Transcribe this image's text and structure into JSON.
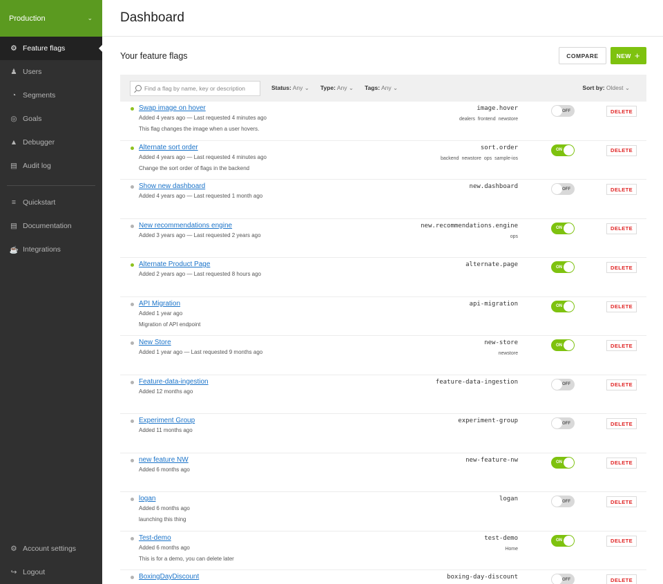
{
  "sidebar": {
    "environment": "Production",
    "nav": [
      {
        "label": "Feature flags",
        "icon": "sliders-icon",
        "active": true
      },
      {
        "label": "Users",
        "icon": "users-icon"
      },
      {
        "label": "Segments",
        "icon": "pie-icon"
      },
      {
        "label": "Goals",
        "icon": "target-icon"
      },
      {
        "label": "Debugger",
        "icon": "bug-icon"
      },
      {
        "label": "Audit log",
        "icon": "log-icon"
      }
    ],
    "nav2": [
      {
        "label": "Quickstart",
        "icon": "rocket-icon"
      },
      {
        "label": "Documentation",
        "icon": "book-icon"
      },
      {
        "label": "Integrations",
        "icon": "plug-icon"
      }
    ],
    "bottom": [
      {
        "label": "Account settings",
        "icon": "gear-icon"
      },
      {
        "label": "Logout",
        "icon": "logout-icon"
      }
    ]
  },
  "header": {
    "title": "Dashboard"
  },
  "section": {
    "title": "Your feature flags",
    "compare": "COMPARE",
    "new": "NEW"
  },
  "filters": {
    "search_placeholder": "Find a flag by name, key or description",
    "status_label": "Status:",
    "status_value": "Any",
    "type_label": "Type:",
    "type_value": "Any",
    "tags_label": "Tags:",
    "tags_value": "Any",
    "sort_label": "Sort by:",
    "sort_value": "Oldest"
  },
  "toggle_labels": {
    "on": "ON",
    "off": "OFF"
  },
  "delete_label": "DELETE",
  "flags": [
    {
      "name": "Swap image on hover",
      "meta": "Added 4 years ago — Last requested 4 minutes ago",
      "desc": "This flag changes the image when a user hovers.",
      "key": "image.hover",
      "tags": [
        "dealers",
        "frontend",
        "newstore"
      ],
      "on": false,
      "live": true
    },
    {
      "name": "Alternate sort order",
      "meta": "Added 4 years ago — Last requested 4 minutes ago",
      "desc": "Change the sort order of flags in the backend",
      "key": "sort.order",
      "tags": [
        "backend",
        "newstore",
        "ops",
        "sample-ios"
      ],
      "on": true,
      "live": true
    },
    {
      "name": "Show new dashboard",
      "meta": "Added 4 years ago — Last requested 1 month ago",
      "desc": "",
      "key": "new.dashboard",
      "tags": [],
      "on": false,
      "live": false
    },
    {
      "name": "New recommendations engine",
      "meta": "Added 3 years ago — Last requested 2 years ago",
      "desc": "",
      "key": "new.recommendations.engine",
      "tags": [
        "ops"
      ],
      "on": true,
      "live": false
    },
    {
      "name": "Alternate Product Page",
      "meta": "Added 2 years ago — Last requested 8 hours ago",
      "desc": "",
      "key": "alternate.page",
      "tags": [],
      "on": true,
      "live": true
    },
    {
      "name": "API Migration",
      "meta": "Added 1 year ago",
      "desc": "Migration of API endpoint",
      "key": "api-migration",
      "tags": [],
      "on": true,
      "live": false
    },
    {
      "name": "New Store",
      "meta": "Added 1 year ago — Last requested 9 months ago",
      "desc": "",
      "key": "new-store",
      "tags": [
        "newstore"
      ],
      "on": true,
      "live": false
    },
    {
      "name": "Feature-data-ingestion",
      "meta": "Added 12 months ago",
      "desc": "",
      "key": "feature-data-ingestion",
      "tags": [],
      "on": false,
      "live": false
    },
    {
      "name": "Experiment Group",
      "meta": "Added 11 months ago",
      "desc": "",
      "key": "experiment-group",
      "tags": [],
      "on": false,
      "live": false
    },
    {
      "name": "new feature NW",
      "meta": "Added 6 months ago",
      "desc": "",
      "key": "new-feature-nw",
      "tags": [],
      "on": true,
      "live": false
    },
    {
      "name": "logan",
      "meta": "Added 6 months ago",
      "desc": "launching this thing",
      "key": "logan",
      "tags": [],
      "on": false,
      "live": false
    },
    {
      "name": "Test-demo",
      "meta": "Added 6 months ago",
      "desc": "This is for a demo, you can delete later",
      "key": "test-demo",
      "tags": [
        "Home"
      ],
      "on": true,
      "live": false
    },
    {
      "name": "BoxingDayDiscount",
      "meta": "",
      "desc": "",
      "key": "boxing-day-discount",
      "tags": [],
      "on": false,
      "live": false
    }
  ]
}
